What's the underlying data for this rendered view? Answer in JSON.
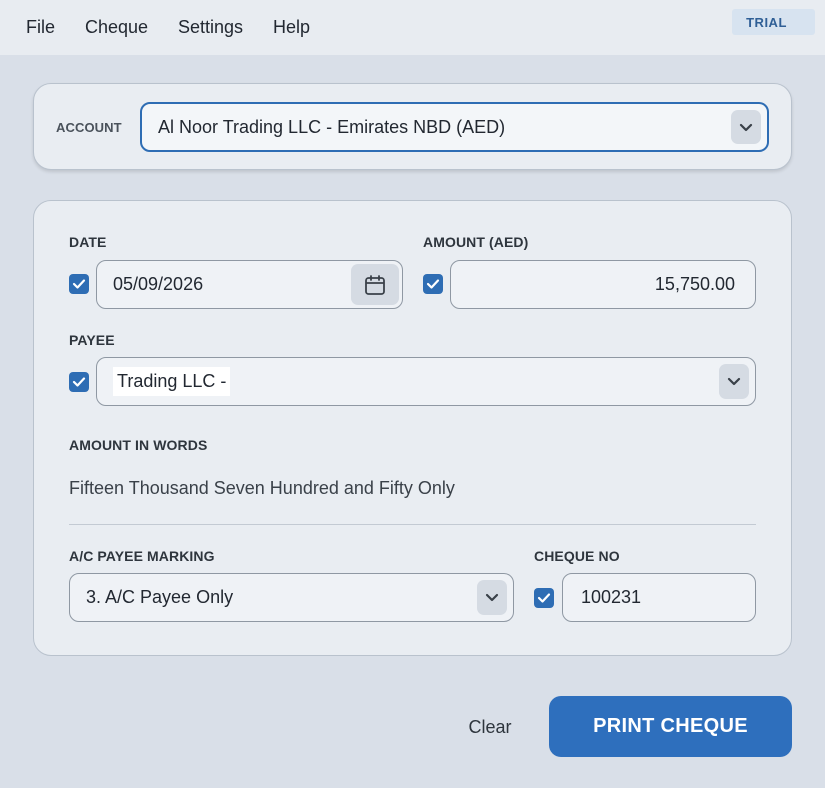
{
  "menu": {
    "file": "File",
    "cheque": "Cheque",
    "settings": "Settings",
    "help": "Help"
  },
  "badge": {
    "trial": "TRIAL"
  },
  "account": {
    "label": "ACCOUNT",
    "value": "Al Noor Trading LLC - Emirates NBD (AED)"
  },
  "form": {
    "date": {
      "label": "DATE",
      "value": "05/09/2026",
      "checked": true
    },
    "amount": {
      "label": "AMOUNT (AED)",
      "value": "15,750.00",
      "checked": true
    },
    "payee": {
      "label": "PAYEE",
      "value": "Trading LLC -",
      "checked": true
    },
    "amount_words": {
      "label": "AMOUNT IN WORDS",
      "value": "Fifteen Thousand Seven Hundred and Fifty Only"
    },
    "ac_payee": {
      "label": "A/C PAYEE MARKING",
      "value": "3.  A/C Payee Only"
    },
    "cheque_no": {
      "label": "CHEQUE NO",
      "value": "100231",
      "checked": true
    }
  },
  "actions": {
    "clear": "Clear",
    "print": "PRINT CHEQUE"
  },
  "colors": {
    "accent": "#2e6db4",
    "background": "#d9dfe8",
    "card": "#e9edf2"
  }
}
